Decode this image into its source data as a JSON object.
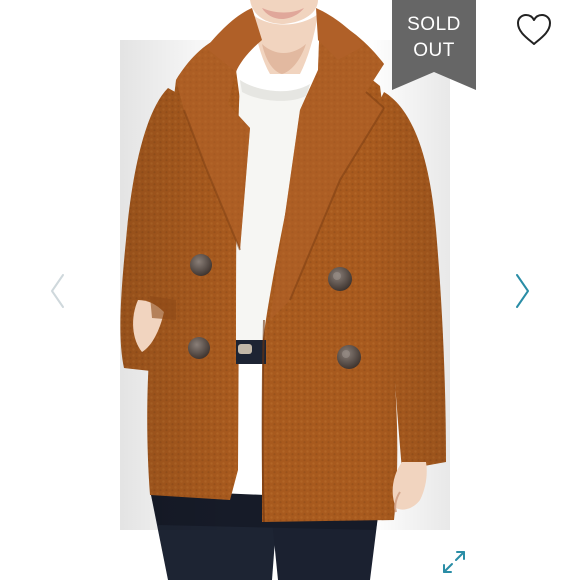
{
  "badge": {
    "line1": "SOLD",
    "line2": "OUT",
    "color": "#666666"
  },
  "icons": {
    "like": "heart-outline-icon",
    "prev": "chevron-left-icon",
    "next": "chevron-right-icon",
    "expand": "expand-arrows-icon"
  },
  "colors": {
    "coat": "#a85a1e",
    "sweater": "#f6f6f3",
    "jeans": "#1d2433",
    "skin": "#f1d4bf",
    "accent": "#2a8da6",
    "nav_inactive": "#cfd8dc"
  }
}
